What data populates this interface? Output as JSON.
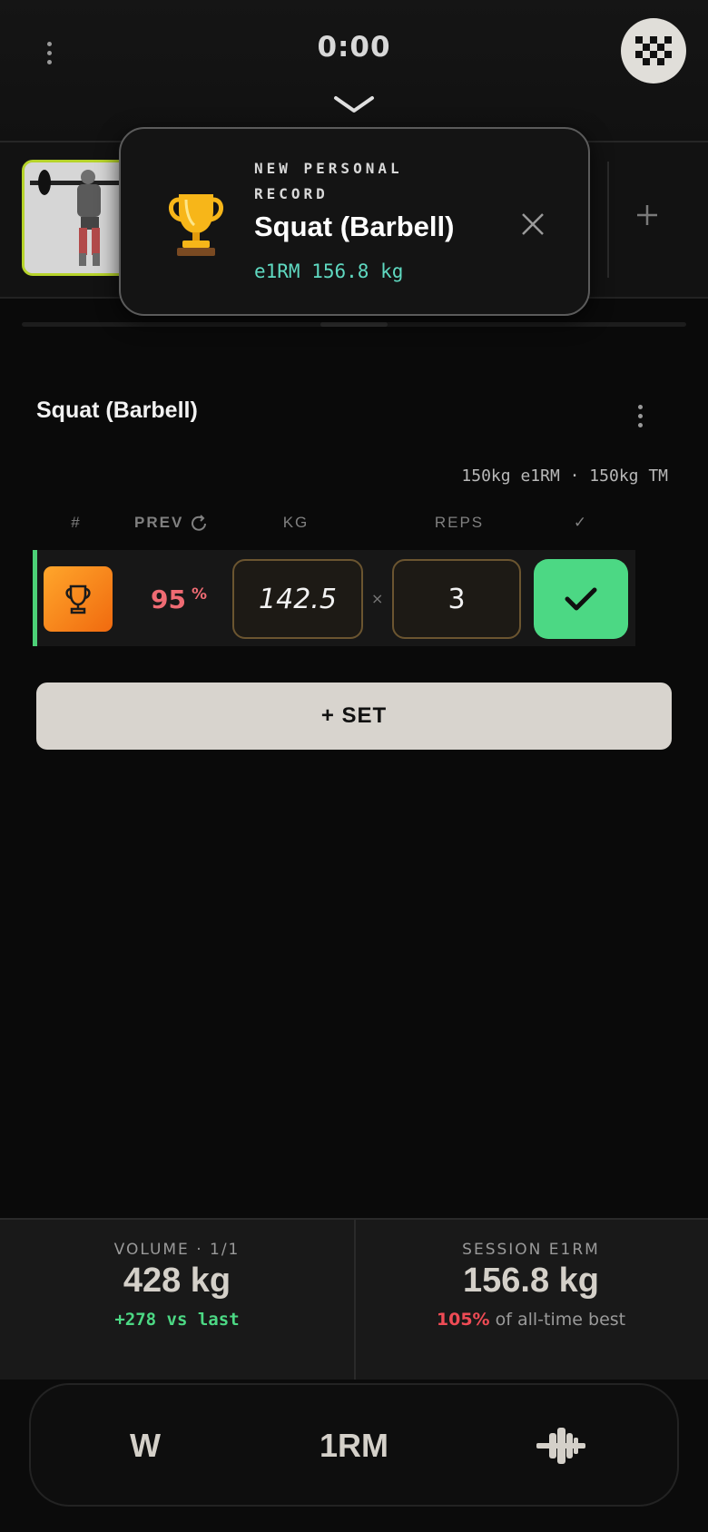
{
  "header": {
    "timer": "0:00"
  },
  "toast": {
    "kicker": "NEW PERSONAL RECORD",
    "title": "Squat (Barbell)",
    "subtitle": "e1RM 156.8 kg"
  },
  "exercise": {
    "title": "Squat (Barbell)",
    "training_max_line": "150kg e1RM · 150kg TM",
    "columns": {
      "set": "#",
      "prev": "PREV",
      "kg": "KG",
      "reps": "REPS",
      "done": "✓"
    },
    "sets": [
      {
        "prev_percent": "95",
        "prev_unit": "%",
        "kg": "142.5",
        "times": "×",
        "reps": "3",
        "completed": true
      }
    ],
    "add_set_label": "+ SET"
  },
  "stats": {
    "volume": {
      "label": "VOLUME · 1/1",
      "value": "428 kg",
      "delta": "+278 vs last"
    },
    "e1rm": {
      "label": "SESSION E1RM",
      "value": "156.8 kg",
      "pct": "105%",
      "pct_text": " of all-time best"
    }
  },
  "bottom_nav": {
    "warmup": "W",
    "one_rm": "1RM",
    "plates_icon": "barbell-plates-icon"
  },
  "colors": {
    "accent_green": "#4cd884",
    "pr_orange": "#f5861d",
    "teal": "#5fd9c1",
    "red": "#ef6b73"
  }
}
